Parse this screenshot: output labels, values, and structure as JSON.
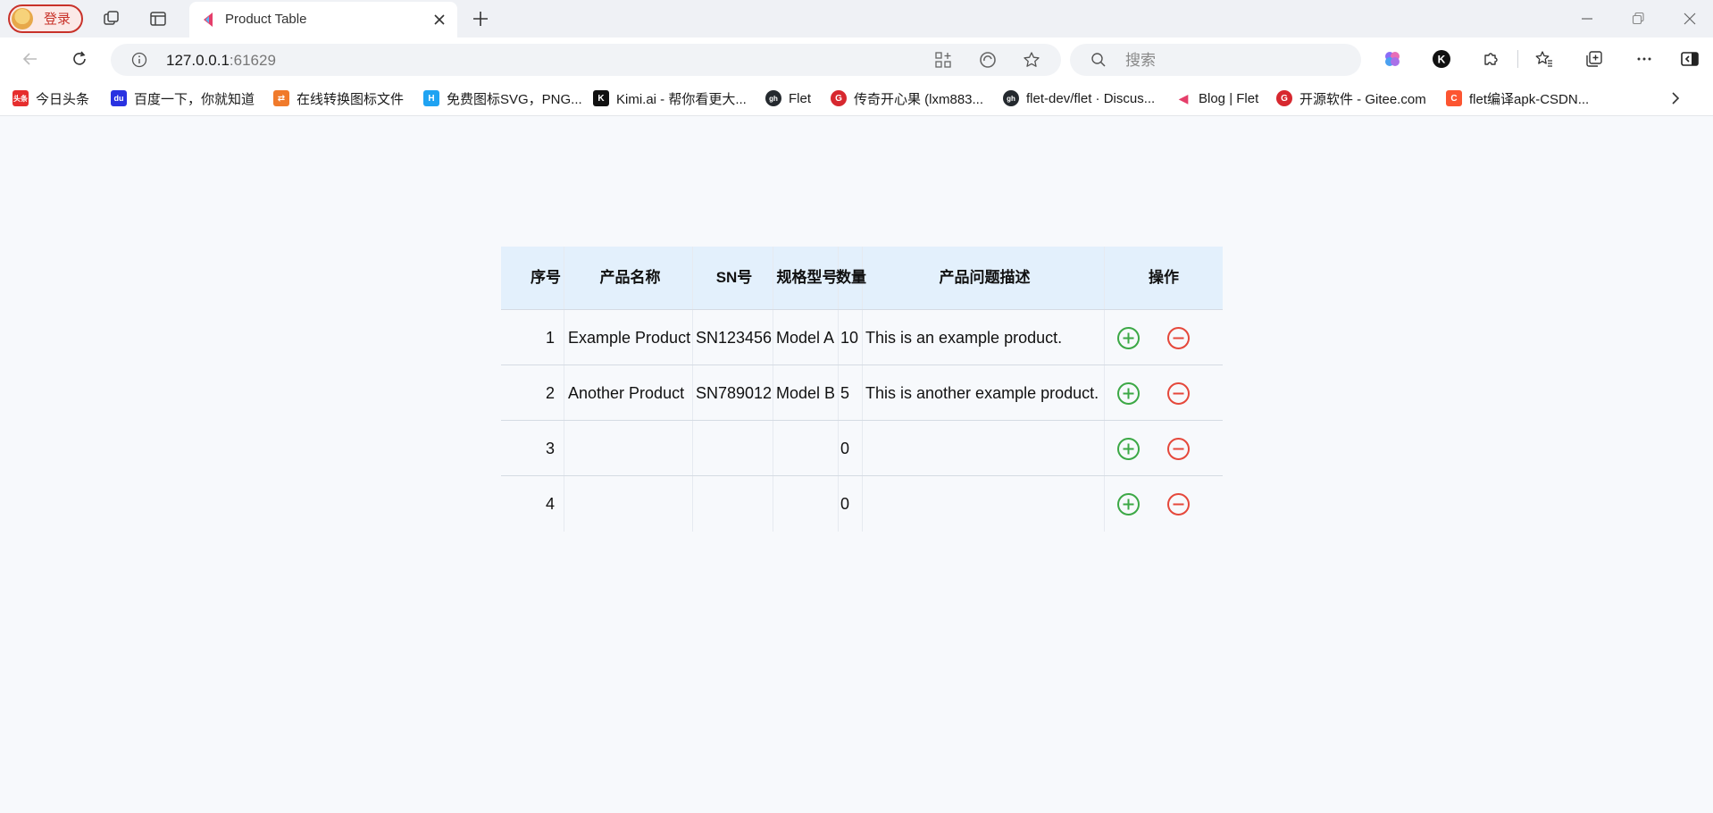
{
  "browser": {
    "login_label": "登录",
    "tab_title": "Product Table",
    "address_host": "127.0.0.1",
    "address_port": ":61629",
    "search_placeholder": "搜索",
    "icons": {
      "workspaces": "workspaces-icon",
      "tab_actions": "tab-actions-icon",
      "close": "close-icon",
      "new_tab": "plus-icon",
      "back": "back-arrow-icon",
      "refresh": "refresh-icon",
      "info": "info-icon",
      "apps": "apps-icon",
      "immersive_reader": "edge-icon",
      "favorite": "star-icon",
      "search": "search-icon",
      "copilot": "copilot-icon",
      "kimi_ext": "kimi-icon",
      "extensions": "puzzle-icon",
      "favorites": "favorites-icon",
      "collections": "collections-icon",
      "more": "more-icon",
      "sidebar": "sidebar-icon",
      "minimize": "minimize-icon",
      "restore": "restore-icon",
      "window_close": "close-icon"
    }
  },
  "bookmarks": [
    {
      "label": "今日头条",
      "icon_color": "#e62e2e",
      "icon_text": "头条"
    },
    {
      "label": "百度一下，你就知道",
      "icon_color": "#2932e1",
      "icon_text": "du"
    },
    {
      "label": "在线转换图标文件",
      "icon_color": "#f07a2b",
      "icon_text": "⇄"
    },
    {
      "label": "免费图标SVG，PNG...",
      "icon_color": "#1fa3f2",
      "icon_text": "H"
    },
    {
      "label": "Kimi.ai - 帮你看更大...",
      "icon_color": "#111111",
      "icon_text": "K"
    },
    {
      "label": "Flet",
      "icon_color": "#24292e",
      "icon_text": "gh"
    },
    {
      "label": "传奇开心果 (lxm883...",
      "icon_color": "#d7282f",
      "icon_text": "G"
    },
    {
      "label": "flet-dev/flet · Discus...",
      "icon_color": "#24292e",
      "icon_text": "gh"
    },
    {
      "label": "Blog | Flet",
      "icon_color": "#e53e6a",
      "icon_text": "◀"
    },
    {
      "label": "开源软件 - Gitee.com",
      "icon_color": "#d7282f",
      "icon_text": "G"
    },
    {
      "label": "flet编译apk-CSDN...",
      "icon_color": "#fc5531",
      "icon_text": "C"
    }
  ],
  "table": {
    "columns": [
      "序号",
      "产品名称",
      "SN号",
      "规格型号",
      "数量",
      "产品问题描述",
      "操作"
    ],
    "rows": [
      {
        "index": "1",
        "name": "Example Product",
        "sn": "SN123456",
        "model": "Model A",
        "qty": "10",
        "desc": "This is an example product."
      },
      {
        "index": "2",
        "name": "Another Product",
        "sn": "SN789012",
        "model": "Model B",
        "qty": "5",
        "desc": "This is another example product."
      },
      {
        "index": "3",
        "name": "",
        "sn": "",
        "model": "",
        "qty": "0",
        "desc": ""
      },
      {
        "index": "4",
        "name": "",
        "sn": "",
        "model": "",
        "qty": "0",
        "desc": ""
      }
    ],
    "add_icon": "add-circle-icon",
    "remove_icon": "remove-circle-icon",
    "add_color": "#3ca846",
    "remove_color": "#e5483b",
    "header_color": "#e3f0fc"
  }
}
